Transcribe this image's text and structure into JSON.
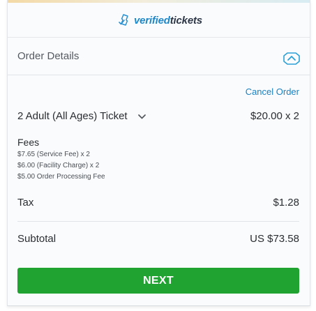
{
  "brand": {
    "name_part1": "verified",
    "name_part2": "tickets"
  },
  "order": {
    "title": "Order Details",
    "cancel_label": "Cancel Order",
    "ticket": {
      "label": "2 Adult (All Ages) Ticket",
      "price": "$20.00 x 2"
    },
    "fees": {
      "title": "Fees",
      "items": [
        "$7.65 (Service Fee) x 2",
        "$6.00 (Facility Charge) x 2",
        "$5.00 Order Processing Fee"
      ]
    },
    "tax": {
      "label": "Tax",
      "value": "$1.28"
    },
    "subtotal": {
      "label": "Subtotal",
      "value": "US $73.58"
    },
    "next_label": "NEXT"
  },
  "icons": {
    "logo": "ticket-check-icon",
    "collapse": "chevron-up-icon",
    "dropdown": "chevron-down-icon"
  },
  "colors": {
    "accent": "#1a7fc1",
    "button": "#21a332"
  }
}
